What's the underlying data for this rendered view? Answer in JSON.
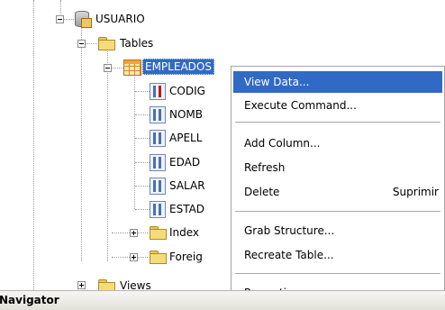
{
  "tree": {
    "database": "USUARIO",
    "tables_folder": "Tables",
    "table": "EMPLEADOS",
    "columns": [
      "CODIG",
      "NOMB",
      "APELL",
      "EDAD",
      "SALAR",
      "ESTAD"
    ],
    "indexes_folder": "Index",
    "foreign_folder": "Foreig",
    "views_folder": "Views"
  },
  "context_menu": {
    "items": [
      {
        "label": "View Data...",
        "shortcut": ""
      },
      {
        "label": "Execute Command...",
        "shortcut": ""
      },
      {
        "label": "Add Column...",
        "shortcut": ""
      },
      {
        "label": "Refresh",
        "shortcut": ""
      },
      {
        "label": "Delete",
        "shortcut": "Suprimir"
      },
      {
        "label": "Grab Structure...",
        "shortcut": ""
      },
      {
        "label": "Recreate Table...",
        "shortcut": ""
      },
      {
        "label": "Properties",
        "shortcut": ""
      }
    ]
  },
  "navigator": {
    "title": "Navigator"
  },
  "colors": {
    "selection": "#316ac5",
    "menu_bg": "#ffffff"
  }
}
